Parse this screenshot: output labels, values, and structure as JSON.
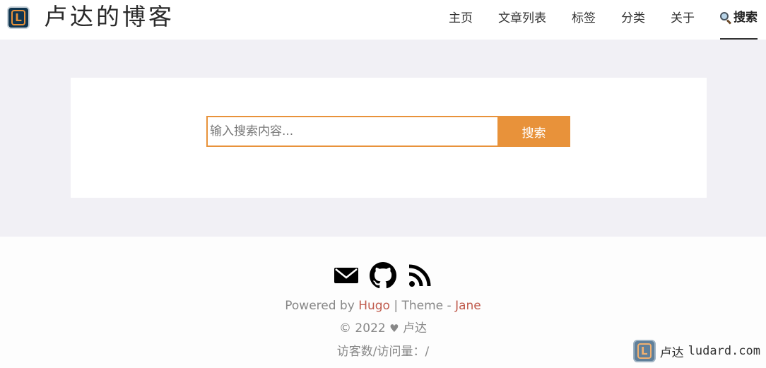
{
  "header": {
    "logo_letter": "L",
    "site_title": "卢达的博客",
    "nav": [
      {
        "label": "主页"
      },
      {
        "label": "文章列表"
      },
      {
        "label": "标签"
      },
      {
        "label": "分类"
      },
      {
        "label": "关于"
      },
      {
        "label": "搜索",
        "icon": "magnifier-icon",
        "active": true
      }
    ]
  },
  "search": {
    "placeholder": "输入搜索内容...",
    "value": "",
    "button_label": "搜索"
  },
  "footer": {
    "social": [
      {
        "icon": "email-icon"
      },
      {
        "icon": "github-icon"
      },
      {
        "icon": "rss-icon"
      }
    ],
    "powered_prefix": "Powered by ",
    "powered_link": "Hugo",
    "theme_sep": " | Theme - ",
    "theme_link": "Jane",
    "copyright_prefix": "© 2022 ",
    "copyright_author": " 卢达",
    "visits_label": "访客数/访问量：/"
  },
  "watermark": {
    "logo_letter": "L",
    "text_cn": "卢达",
    "text_domain": "ludard.com"
  },
  "colors": {
    "accent": "#e8923a",
    "link": "#c05b4d",
    "main_bg": "#f1f0f5",
    "logo_bg": "#0f3550"
  }
}
